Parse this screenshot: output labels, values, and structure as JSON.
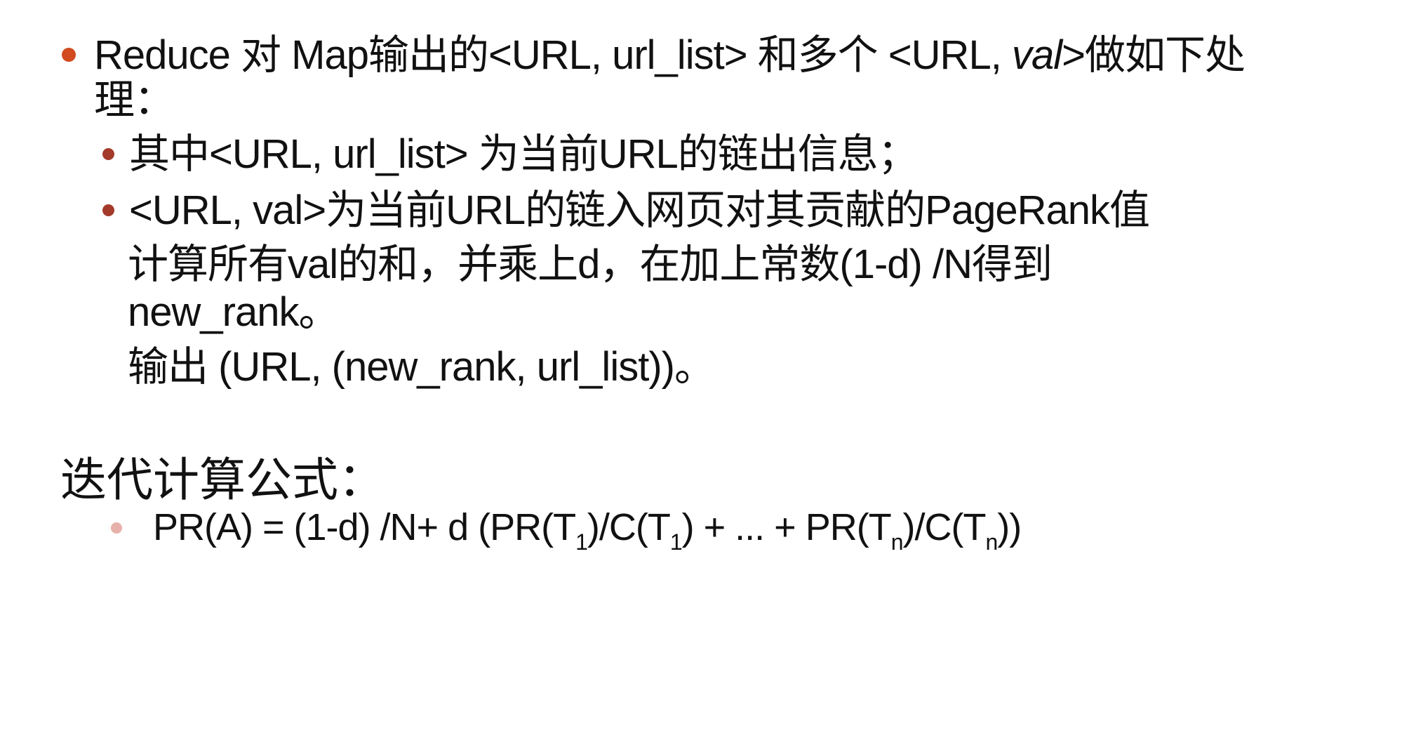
{
  "colors": {
    "bullet_primary": "#d24a1f",
    "bullet_secondary": "#a33a2a",
    "bullet_formula": "#e8b0aa",
    "text": "#111111"
  },
  "items": [
    {
      "level": 1,
      "segments": [
        {
          "text": "Reduce 对 Map输出的<URL, url_list> 和多个 <URL, ",
          "italic": false
        },
        {
          "text": "val",
          "italic": true
        },
        {
          "text": ">做如下处",
          "italic": false
        }
      ],
      "continuation": "理："
    },
    {
      "level": 2,
      "text": "其中<URL, url_list> 为当前URL的链出信息；"
    },
    {
      "level": 2,
      "text": " <URL, val>为当前URL的链入网页对其贡献的PageRank值"
    }
  ],
  "paragraphs": [
    "计算所有val的和，并乘上d，在加上常数(1-d) /N得到",
    "new_rank。",
    " 输出 (URL, (new_rank, url_list))。"
  ],
  "heading": "迭代计算公式：",
  "formula": {
    "prefix": "PR(A) = (1-d) /N+ d (PR(T",
    "sub1": "1",
    "mid1": ")/C(T",
    "sub2": "1",
    "mid2": ") + ... + PR(T",
    "sub3": "n",
    "mid3": ")/C(T",
    "sub4": "n",
    "suffix": "))"
  }
}
